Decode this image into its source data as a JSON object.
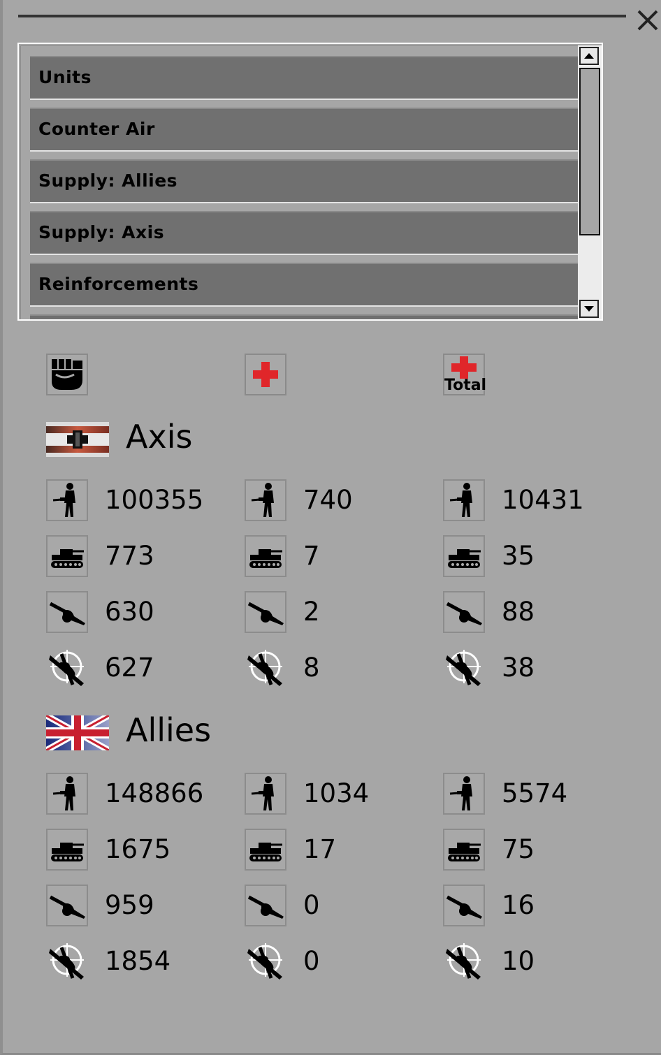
{
  "list": {
    "items": [
      "Units",
      "Counter Air",
      "Supply: Allies",
      "Supply: Axis",
      "Reinforcements"
    ]
  },
  "columns": [
    {
      "icon": "fist-icon",
      "label": ""
    },
    {
      "icon": "red-cross-icon",
      "label": ""
    },
    {
      "icon": "red-cross-total-icon",
      "label": "Total"
    }
  ],
  "factions": [
    {
      "name": "Axis",
      "flag_icon": "iron-cross-flag-icon",
      "rows": [
        {
          "icon": "infantry-icon",
          "values": [
            "100355",
            "740",
            "10431"
          ]
        },
        {
          "icon": "tank-icon",
          "values": [
            "773",
            "7",
            "35"
          ]
        },
        {
          "icon": "artillery-icon",
          "values": [
            "630",
            "2",
            "88"
          ]
        },
        {
          "icon": "aircraft-icon",
          "values": [
            "627",
            "8",
            "38"
          ]
        }
      ]
    },
    {
      "name": "Allies",
      "flag_icon": "union-jack-flag-icon",
      "rows": [
        {
          "icon": "infantry-icon",
          "values": [
            "148866",
            "1034",
            "5574"
          ]
        },
        {
          "icon": "tank-icon",
          "values": [
            "1675",
            "17",
            "75"
          ]
        },
        {
          "icon": "artillery-icon",
          "values": [
            "959",
            "0",
            "16"
          ]
        },
        {
          "icon": "aircraft-icon",
          "values": [
            "1854",
            "0",
            "10"
          ]
        }
      ]
    }
  ],
  "colors": {
    "panel": "#a6a6a6",
    "list_item": "#707070",
    "cross_red": "#e0262a"
  }
}
